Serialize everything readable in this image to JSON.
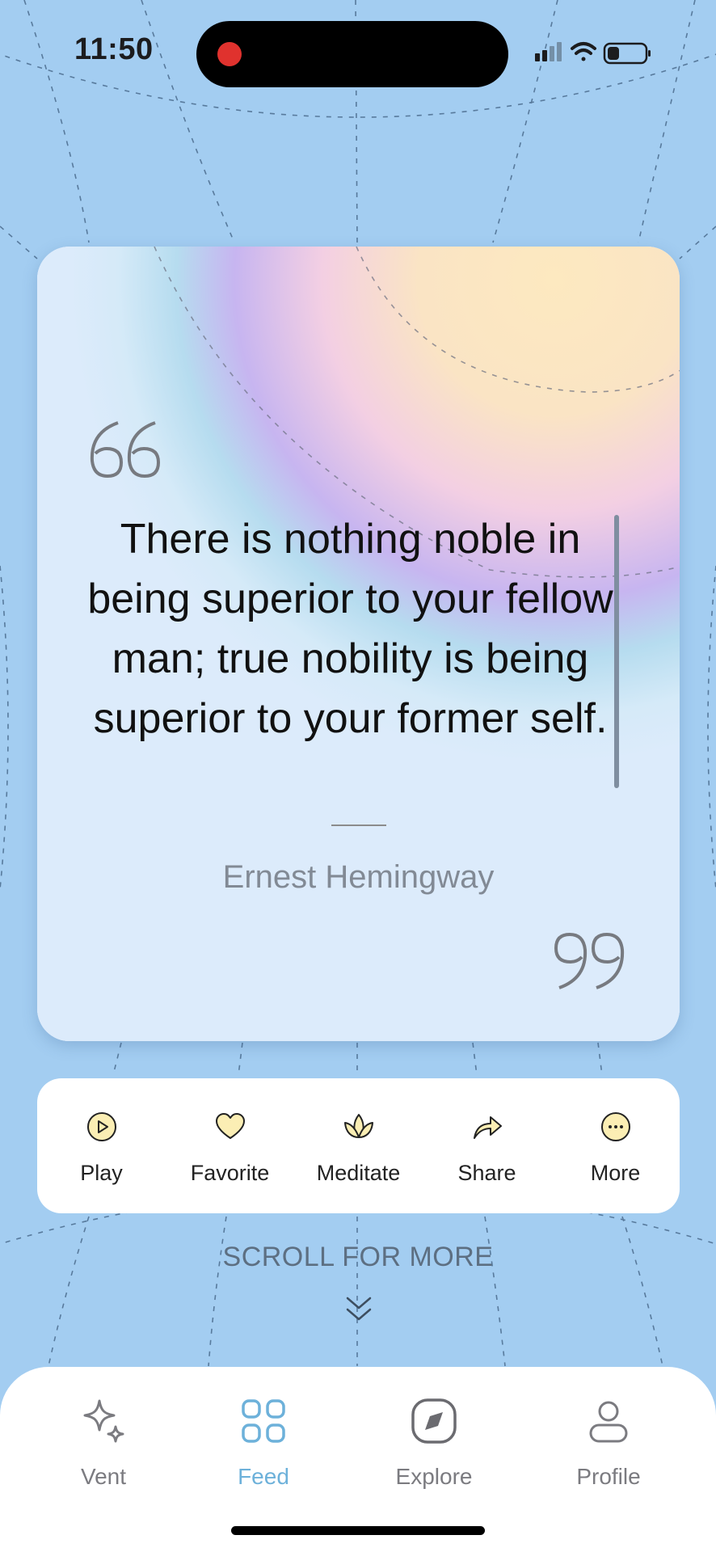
{
  "status": {
    "time": "11:50"
  },
  "quote": {
    "text": "There is nothing noble in being superior to your fellow man; true nobility is being superior to your former self.",
    "author": "Ernest Hemingway",
    "open_mark_icon": "open-quote-icon",
    "close_mark_icon": "close-quote-icon"
  },
  "actions": [
    {
      "label": "Play",
      "icon": "play-icon"
    },
    {
      "label": "Favorite",
      "icon": "heart-icon"
    },
    {
      "label": "Meditate",
      "icon": "lotus-icon"
    },
    {
      "label": "Share",
      "icon": "share-arrow-icon"
    },
    {
      "label": "More",
      "icon": "more-dots-icon"
    }
  ],
  "scroll_hint": "SCROLL FOR MORE",
  "tabs": [
    {
      "label": "Vent",
      "icon": "sparkle-icon",
      "active": false
    },
    {
      "label": "Feed",
      "icon": "grid-icon",
      "active": true
    },
    {
      "label": "Explore",
      "icon": "compass-icon",
      "active": false
    },
    {
      "label": "Profile",
      "icon": "person-icon",
      "active": false
    }
  ],
  "colors": {
    "background": "#a3cdf1",
    "accent": "#6db1da",
    "icon_fill": "#fbeeb4",
    "recording_dot": "#e0322e"
  }
}
